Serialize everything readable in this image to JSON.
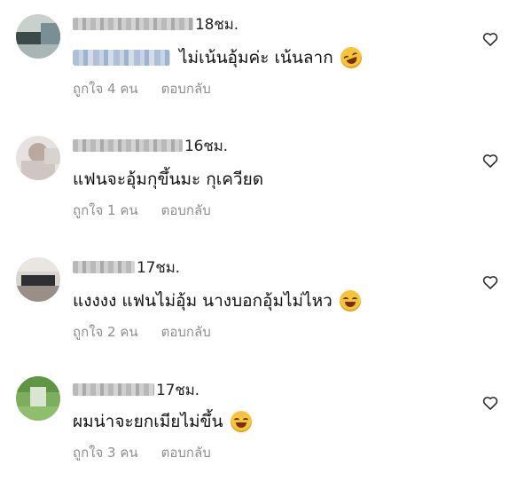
{
  "comments": [
    {
      "time": "18ชม.",
      "text": "ไม่เน้นอุ้มค่ะ เน้นลาก",
      "likes": "ถูกใจ 4 คน",
      "reply": "ตอบกลับ"
    },
    {
      "time": "16ชม.",
      "text": "แฟนจะอุ้มกุขึ้นมะ กุเควียด",
      "likes": "ถูกใจ 1 คน",
      "reply": "ตอบกลับ"
    },
    {
      "time": "17ชม.",
      "text": "แงงงง แฟนไม่อุ้ม นางบอกอุ้มไม่ไหว",
      "likes": "ถูกใจ 2 คน",
      "reply": "ตอบกลับ"
    },
    {
      "time": "17ชม.",
      "text": "ผมน่าจะยกเมียไม่ขึ้น",
      "likes": "ถูกใจ 3 คน",
      "reply": "ตอบกลับ"
    }
  ],
  "icons": {
    "like": "heart-outline-icon",
    "emoji_1": "rolling-on-floor-laughing-icon",
    "emoji_3": "tears-of-joy-icon",
    "emoji_4": "tears-of-joy-icon"
  }
}
